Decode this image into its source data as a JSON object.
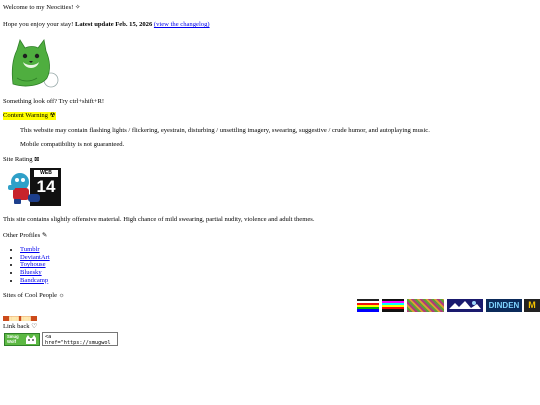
{
  "intro": {
    "welcome": "Welcome to my Neocities! ✧",
    "hope": "Hope you enjoy your stay! ",
    "latest_update": "Latest update Feb. 15, 2026",
    "changelog_link": "(view the changelog)"
  },
  "avatar": {
    "icon": "cat-avatar-icon"
  },
  "refresh_tip": "Something look off? Try ctrl+shift+R!",
  "content_warning": {
    "label": "Content Warning ☢",
    "text": "This website may contain flashing lights / flickering, eyestrain, disturbing / unsettling imagery, swearing, suggestive / crude humor, and autoplaying music.",
    "mobile": "Mobile compatibility is not guaranteed."
  },
  "rating": {
    "heading": "Site Rating ⊠",
    "badge_top": "WEB",
    "badge_number": "14",
    "description": "This site contains slightly offensive material. High chance of mild swearing, partial nudity, violence and adult themes."
  },
  "profiles": {
    "heading": "Other Profiles ✎",
    "items": [
      "Tumblr",
      "DeviantArt",
      "Toyhouse",
      "Bluesky",
      "Bandcamp"
    ]
  },
  "cool_sites": {
    "heading": "Sites of Cool People ☼",
    "badge_texts": [
      "DINDEN",
      "M"
    ]
  },
  "link_back": {
    "heading": "Link back ♡",
    "button_text": "Smug Wolf",
    "code": "<a href=\"https://smugwol",
    "small_banner": "████ ████"
  },
  "colors": {
    "link": "#0000ee",
    "highlight": "#ffff00",
    "avatar_green": "#4fae3f",
    "dinden_bg": "#0b2a5a",
    "linkback_green": "#5cb843"
  }
}
